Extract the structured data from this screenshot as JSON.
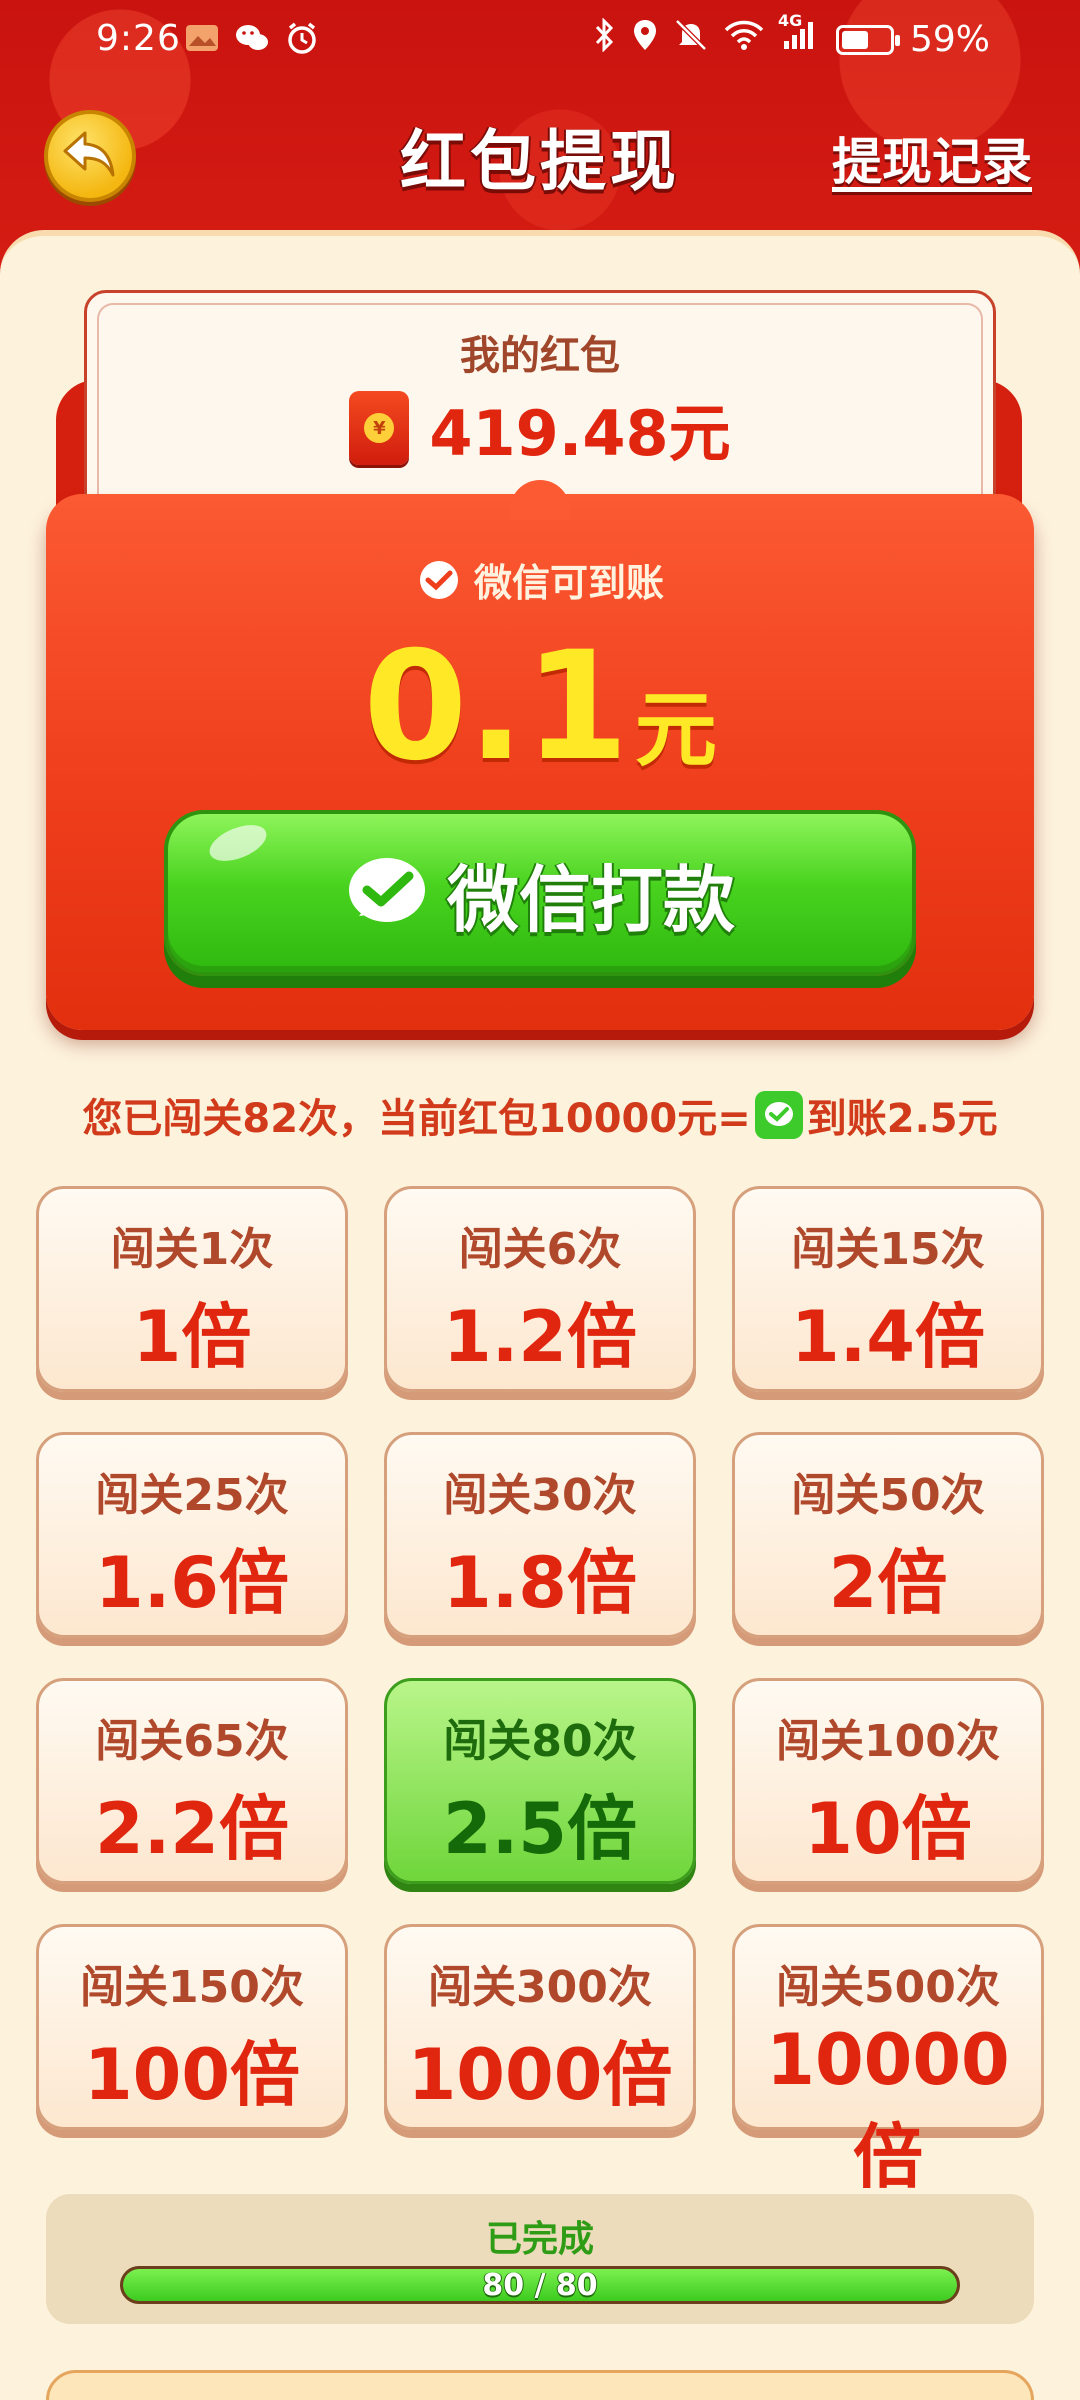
{
  "status_bar": {
    "time": "9:26",
    "battery_percent": "59%",
    "battery_level": 0.59,
    "network": "4G",
    "left_icons": [
      "gallery-icon",
      "wechat-icon",
      "alarm-icon"
    ],
    "right_icons": [
      "bluetooth-icon",
      "location-icon",
      "mute-icon",
      "wifi-icon",
      "signal-icon",
      "battery-icon"
    ]
  },
  "header": {
    "title": "红包提现",
    "record_link": "提现记录",
    "back_icon": "back-arrow-icon"
  },
  "balance": {
    "label": "我的红包",
    "amount": "419.48元",
    "icon": "hongbao-icon",
    "coin_symbol": "¥"
  },
  "withdraw": {
    "arrival_label": "微信可到账",
    "arrival_value": "0.1",
    "arrival_unit": "元",
    "pay_button_label": "微信打款"
  },
  "progress_desc": {
    "part1": "您已闯关82次，当前红包10000元=",
    "part2": "到账2.5元"
  },
  "tiers": [
    {
      "label": "闯关1次",
      "multiplier": "1倍",
      "active": false
    },
    {
      "label": "闯关6次",
      "multiplier": "1.2倍",
      "active": false
    },
    {
      "label": "闯关15次",
      "multiplier": "1.4倍",
      "active": false
    },
    {
      "label": "闯关25次",
      "multiplier": "1.6倍",
      "active": false
    },
    {
      "label": "闯关30次",
      "multiplier": "1.8倍",
      "active": false
    },
    {
      "label": "闯关50次",
      "multiplier": "2倍",
      "active": false
    },
    {
      "label": "闯关65次",
      "multiplier": "2.2倍",
      "active": false
    },
    {
      "label": "闯关80次",
      "multiplier": "2.5倍",
      "active": true
    },
    {
      "label": "闯关100次",
      "multiplier": "10倍",
      "active": false
    },
    {
      "label": "闯关150次",
      "multiplier": "100倍",
      "active": false
    },
    {
      "label": "闯关300次",
      "multiplier": "1000倍",
      "active": false
    },
    {
      "label": "闯关500次",
      "multiplier": "10000倍",
      "active": false
    }
  ],
  "completion": {
    "label": "已完成",
    "progress_text": "80 / 80",
    "progress_fraction": 1.0
  },
  "colors": {
    "primary_red": "#e1260f",
    "wechat_green": "#3ccb2a",
    "gold": "#ffe926",
    "cream": "#fdf2dc"
  }
}
